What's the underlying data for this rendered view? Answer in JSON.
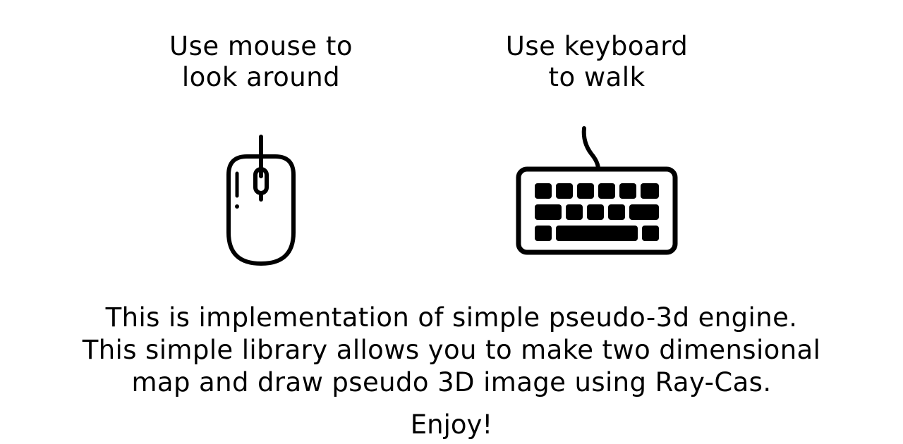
{
  "controls": {
    "mouse": {
      "title_line1": "Use mouse to",
      "title_line2": "look around",
      "icon": "mouse-icon"
    },
    "keyboard": {
      "title_line1": "Use keyboard",
      "title_line2": "to walk",
      "icon": "keyboard-icon"
    }
  },
  "description": {
    "line1": "This is implementation of simple pseudo-3d engine.",
    "line2": "This simple library allows you to make two dimensional",
    "line3": "map and draw pseudo 3D image using Ray-Cas."
  },
  "enjoy": "Enjoy!"
}
